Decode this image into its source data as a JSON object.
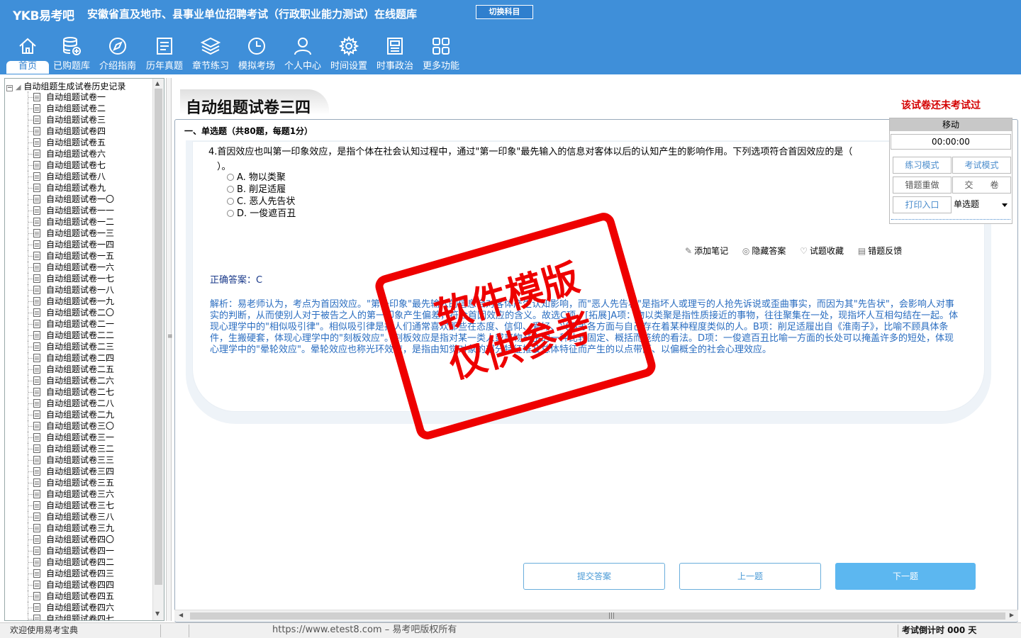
{
  "header": {
    "logo": "YKB易考吧",
    "title": "安徽省直及地市、县事业单位招聘考试（行政职业能力测试）在线题库",
    "switch_label": "切换科目"
  },
  "nav": [
    {
      "label": "首页",
      "icon": "home-icon"
    },
    {
      "label": "已购题库",
      "icon": "database-icon"
    },
    {
      "label": "介绍指南",
      "icon": "compass-icon"
    },
    {
      "label": "历年真题",
      "icon": "document-icon"
    },
    {
      "label": "章节练习",
      "icon": "layers-icon"
    },
    {
      "label": "模拟考场",
      "icon": "clock-icon"
    },
    {
      "label": "个人中心",
      "icon": "user-icon"
    },
    {
      "label": "时间设置",
      "icon": "gear-icon"
    },
    {
      "label": "时事政治",
      "icon": "news-icon"
    },
    {
      "label": "更多功能",
      "icon": "grid-icon"
    }
  ],
  "tree": {
    "root": "自动组题生成试卷历史记录",
    "items": [
      "自动组题试卷一",
      "自动组题试卷二",
      "自动组题试卷三",
      "自动组题试卷四",
      "自动组题试卷五",
      "自动组题试卷六",
      "自动组题试卷七",
      "自动组题试卷八",
      "自动组题试卷九",
      "自动组题试卷一〇",
      "自动组题试卷一一",
      "自动组题试卷一二",
      "自动组题试卷一三",
      "自动组题试卷一四",
      "自动组题试卷一五",
      "自动组题试卷一六",
      "自动组题试卷一七",
      "自动组题试卷一八",
      "自动组题试卷一九",
      "自动组题试卷二〇",
      "自动组题试卷二一",
      "自动组题试卷二二",
      "自动组题试卷二三",
      "自动组题试卷二四",
      "自动组题试卷二五",
      "自动组题试卷二六",
      "自动组题试卷二七",
      "自动组题试卷二八",
      "自动组题试卷二九",
      "自动组题试卷三〇",
      "自动组题试卷三一",
      "自动组题试卷三二",
      "自动组题试卷三三",
      "自动组题试卷三四",
      "自动组题试卷三五",
      "自动组题试卷三六",
      "自动组题试卷三七",
      "自动组题试卷三八",
      "自动组题试卷三九",
      "自动组题试卷四〇",
      "自动组题试卷四一",
      "自动组题试卷四二",
      "自动组题试卷四三",
      "自动组题试卷四四",
      "自动组题试卷四五",
      "自动组题试卷四六",
      "自动组题试卷四七"
    ]
  },
  "paper": {
    "title": "自动组题试卷三四",
    "status": "该试卷还未考试过",
    "section": "一、单选题（共80题，每题1分）"
  },
  "question": {
    "text": "4.首因效应也叫第一印象效应，是指个体在社会认知过程中，通过\"第一印象\"最先输入的信息对客体以后的认知产生的影响作用。下列选项符合首因效应的是（",
    "paren": "）。",
    "options": [
      "A. 物以类聚",
      "B. 削足适履",
      "C. 恶人先告状",
      "D. 一俊遮百丑"
    ],
    "tools": {
      "note": "添加笔记",
      "hide": "隐藏答案",
      "fav": "试题收藏",
      "feedback": "错题反馈"
    },
    "answer": "正确答案：C",
    "analysis": "解析：易老师认为，考点为首因效应。\"第一印象\"最先输入的信息会对客体产生认知影响，而\"恶人先告状\"是指坏人或理亏的人抢先诉说或歪曲事实，而因为其\"先告状\"，会影响人对事实的判断，从而使别人对于被告之人的第一印象产生偏差，符合首因效应的含义。故选C项。[拓展]A项：物以类聚是指性质接近的事物，往往聚集在一处，现指坏人互相勾结在一起。体现心理学中的\"相似吸引律\"。相似吸引律是指人们通常喜欢那些在态度、信仰、爱好、兴趣等各方面与自己存在着某种程度类似的人。B项：削足适履出自《淮南子》，比喻不顾具体条件，生搬硬套，体现心理学中的\"刻板效应\"。刻板效应是指对某一类人或事物产生的一种比较固定、概括而笼统的看法。D项：一俊遮百丑比喻一方面的长处可以掩盖许多的短处，体现心理学中的\"晕轮效应\"。晕轮效应也称光环效应，是指由知觉对象的部分特征推及总体特征而产生的以点带面、以偏概全的社会心理效应。"
  },
  "buttons": {
    "submit": "提交答案",
    "prev": "上一题",
    "next": "下一题"
  },
  "timer": {
    "title": "移动",
    "clock": "00:00:00",
    "practice": "练习模式",
    "exam": "考试模式",
    "redo": "错题重做",
    "hand_in": "交　　卷",
    "print": "打印入口",
    "type": "单选题"
  },
  "stamp": {
    "line1": "软件模版",
    "line2": "仅供参考"
  },
  "status": {
    "welcome": "欢迎使用易考宝典",
    "copyright": "https://www.etest8.com – 易考吧版权所有",
    "countdown": "考试倒计时 000 天"
  },
  "colors": {
    "header": "#3f8fd9",
    "accent": "#5cb7f0",
    "alert": "#d40000",
    "stamp": "#e00000"
  }
}
